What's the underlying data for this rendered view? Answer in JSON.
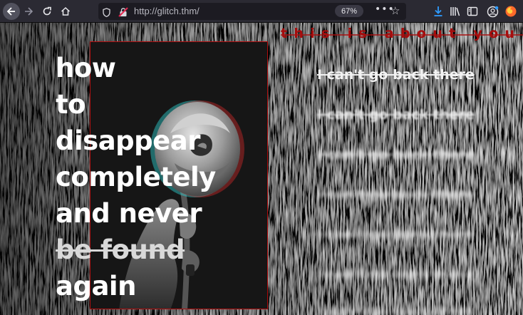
{
  "browser": {
    "url": "http://glitch.thm/",
    "zoom": "67%",
    "icons": {
      "back": "arrow-left-icon",
      "forward": "arrow-right-icon",
      "reload": "reload-icon",
      "home": "home-icon",
      "tracking_protection": "shield-icon",
      "insecure": "lock-slash-icon",
      "more": "ellipsis-icon",
      "bookmark": "star-icon",
      "download": "download-arrow-icon",
      "library": "library-icon",
      "sidebar": "sidebar-icon",
      "account": "account-icon",
      "extension": "firefox-fox-icon"
    },
    "accent_colors": {
      "download": "#2f9bff",
      "insecure": "#e22850",
      "fox": "#ff6a2b"
    }
  },
  "page": {
    "tagline": "this is about you",
    "heading": [
      "how",
      "to",
      "disappear",
      "completely",
      "and never",
      "be found",
      "again"
    ],
    "struck_line": "be found",
    "repeated_line": "I can't go back there",
    "colors": {
      "background": "#050505",
      "text": "#ffffff",
      "accent_red": "#a50d0d"
    }
  }
}
